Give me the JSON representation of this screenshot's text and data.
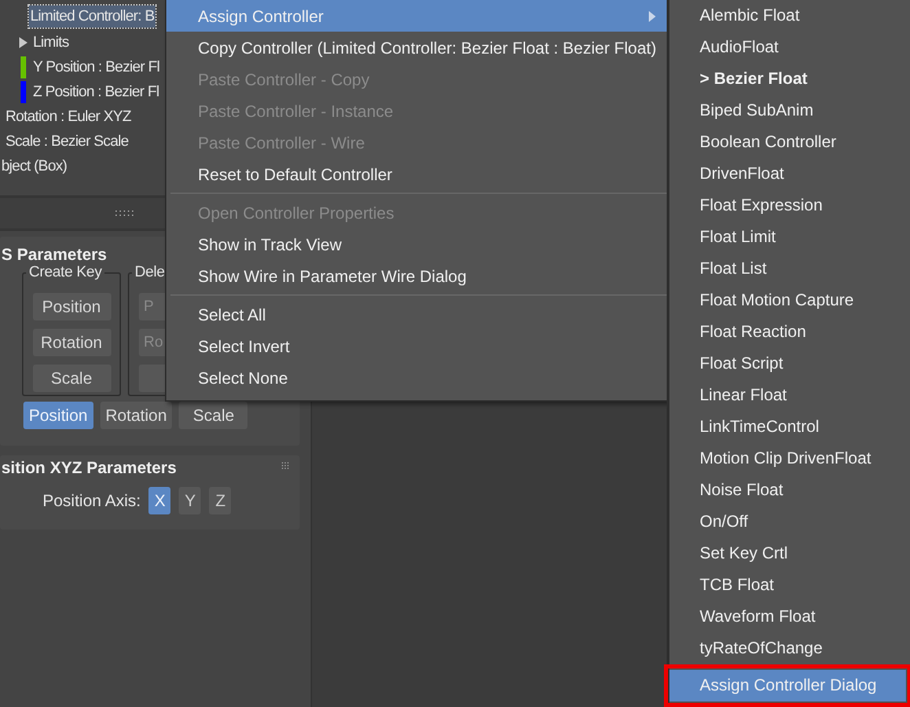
{
  "tree": {
    "rows": [
      {
        "label": "Limited Controller: B",
        "kind": "node",
        "selected": true
      },
      {
        "label": "Limits",
        "kind": "expander",
        "selected": false
      },
      {
        "label": "Y Position : Bezier Fl",
        "kind": "track",
        "color": "#66c000",
        "selected": false
      },
      {
        "label": "Z Position : Bezier Fl",
        "kind": "track",
        "color": "#0000ff",
        "selected": false
      },
      {
        "label": "Rotation : Euler XYZ",
        "kind": "parent",
        "selected": false
      },
      {
        "label": "Scale : Bezier Scale",
        "kind": "parent",
        "selected": false
      },
      {
        "label": "bject (Box)",
        "kind": "root",
        "selected": false
      }
    ]
  },
  "key_rollout": {
    "title": "S Parameters",
    "create_key": {
      "title": "Create Key",
      "buttons": [
        {
          "label": "Position"
        },
        {
          "label": "Rotation"
        },
        {
          "label": "Scale"
        }
      ]
    },
    "delete_key": {
      "title": "Dele",
      "buttons": [
        {
          "label": "P"
        },
        {
          "label": "Ro"
        },
        {
          "kind": "blank"
        }
      ]
    },
    "modes": [
      {
        "label": "Position",
        "selected": true
      },
      {
        "label": "Rotation",
        "selected": false
      },
      {
        "label": "Scale",
        "selected": false
      }
    ]
  },
  "xyz_rollout": {
    "title": "sition XYZ Parameters",
    "axis_label": "Position Axis:",
    "axes": [
      {
        "label": "X",
        "selected": true
      },
      {
        "label": "Y",
        "selected": false
      },
      {
        "label": "Z",
        "selected": false
      }
    ]
  },
  "context_menu": {
    "sections": [
      {
        "items": [
          {
            "label": "Assign Controller",
            "selected": true,
            "disabled": false,
            "submenu": true
          },
          {
            "label": "Copy Controller (Limited Controller: Bezier Float : Bezier Float)",
            "selected": false,
            "disabled": false,
            "submenu": false
          },
          {
            "label": "Paste Controller - Copy",
            "selected": false,
            "disabled": true,
            "submenu": false
          },
          {
            "label": "Paste Controller - Instance",
            "selected": false,
            "disabled": true,
            "submenu": false
          },
          {
            "label": "Paste Controller - Wire",
            "selected": false,
            "disabled": true,
            "submenu": false
          },
          {
            "label": "Reset to Default Controller",
            "selected": false,
            "disabled": false,
            "submenu": false
          }
        ]
      },
      {
        "items": [
          {
            "label": "Open Controller Properties",
            "selected": false,
            "disabled": true,
            "submenu": false
          },
          {
            "label": "Show in Track View",
            "selected": false,
            "disabled": false,
            "submenu": false
          },
          {
            "label": "Show Wire in Parameter Wire Dialog",
            "selected": false,
            "disabled": false,
            "submenu": false
          }
        ]
      },
      {
        "items": [
          {
            "label": "Select All",
            "selected": false,
            "disabled": false,
            "submenu": false
          },
          {
            "label": "Select Invert",
            "selected": false,
            "disabled": false,
            "submenu": false
          },
          {
            "label": "Select None",
            "selected": false,
            "disabled": false,
            "submenu": false
          }
        ]
      }
    ]
  },
  "submenu": {
    "items": [
      {
        "label": "Alembic Float",
        "current": false,
        "selected": false,
        "outlined": false
      },
      {
        "label": "AudioFloat",
        "current": false,
        "selected": false,
        "outlined": false
      },
      {
        "label": "> Bezier Float",
        "current": true,
        "selected": false,
        "outlined": false
      },
      {
        "label": "Biped SubAnim",
        "current": false,
        "selected": false,
        "outlined": false
      },
      {
        "label": "Boolean Controller",
        "current": false,
        "selected": false,
        "outlined": false
      },
      {
        "label": "DrivenFloat",
        "current": false,
        "selected": false,
        "outlined": false
      },
      {
        "label": "Float Expression",
        "current": false,
        "selected": false,
        "outlined": false
      },
      {
        "label": "Float Limit",
        "current": false,
        "selected": false,
        "outlined": false
      },
      {
        "label": "Float List",
        "current": false,
        "selected": false,
        "outlined": false
      },
      {
        "label": "Float Motion Capture",
        "current": false,
        "selected": false,
        "outlined": false
      },
      {
        "label": "Float Reaction",
        "current": false,
        "selected": false,
        "outlined": false
      },
      {
        "label": "Float Script",
        "current": false,
        "selected": false,
        "outlined": false
      },
      {
        "label": "Linear Float",
        "current": false,
        "selected": false,
        "outlined": false
      },
      {
        "label": "LinkTimeControl",
        "current": false,
        "selected": false,
        "outlined": false
      },
      {
        "label": "Motion Clip DrivenFloat",
        "current": false,
        "selected": false,
        "outlined": false
      },
      {
        "label": "Noise Float",
        "current": false,
        "selected": false,
        "outlined": false
      },
      {
        "label": "On/Off",
        "current": false,
        "selected": false,
        "outlined": false
      },
      {
        "label": "Set Key Crtl",
        "current": false,
        "selected": false,
        "outlined": false
      },
      {
        "label": "TCB Float",
        "current": false,
        "selected": false,
        "outlined": false
      },
      {
        "label": "Waveform Float",
        "current": false,
        "selected": false,
        "outlined": false
      },
      {
        "label": "tyRateOfChange",
        "current": false,
        "selected": false,
        "outlined": false
      },
      {
        "label": "Assign Controller Dialog",
        "current": false,
        "selected": true,
        "outlined": true
      }
    ]
  }
}
